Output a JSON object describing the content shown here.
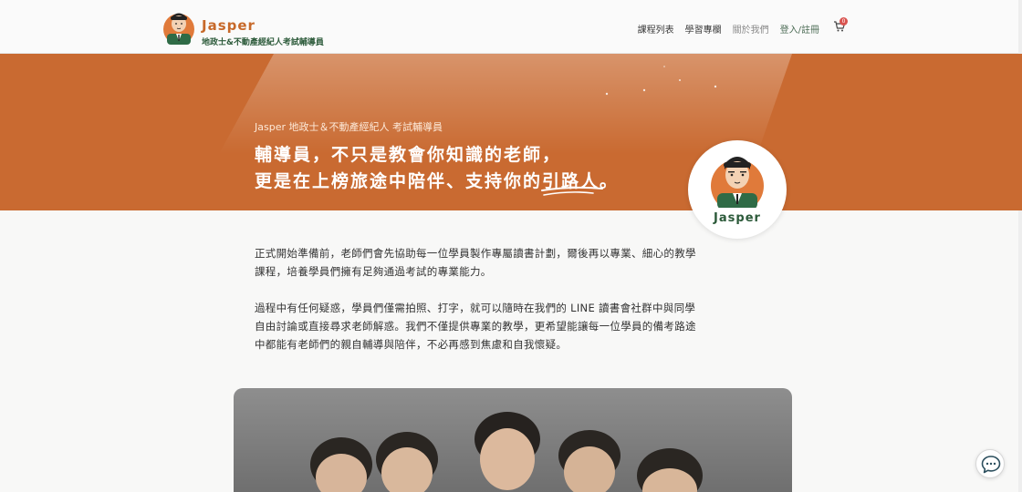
{
  "header": {
    "brand_name": "Jasper",
    "brand_tagline": "地政士&不動產經紀人考試輔導員",
    "nav": [
      {
        "label": "課程列表"
      },
      {
        "label": "學習專欄"
      },
      {
        "label": "關於我們"
      },
      {
        "label": "登入/註冊"
      }
    ],
    "cart_count": "0"
  },
  "hero": {
    "subtitle": "Jasper 地政士＆不動產經紀人 考試輔導員",
    "line1": "輔導員，不只是教會你知識的老師，",
    "line2": "更是在上榜旅途中陪伴、支持你的引路人。",
    "avatar_name": "Jasper"
  },
  "body": {
    "paragraph1": "正式開始準備前，老師們會先協助每一位學員製作專屬讀書計劃，爾後再以專業、細心的教學課程，培養學員們擁有足夠通過考試的專業能力。",
    "paragraph2": "過程中有任何疑惑，學員們僅需拍照、打字，就可以隨時在我們的 LINE 讀書會社群中與同學自由討論或直接尋求老師解惑。我們不僅提供專業的教學，更希望能讓每一位學員的備考路途中都能有老師們的親自輔導與陪伴，不必再感到焦慮和自我懷疑。"
  },
  "colors": {
    "hero_bg": "#c96a31",
    "brand_orange": "#c7692a",
    "brand_green": "#2c5a3a"
  },
  "icons": {
    "cart": "shopping-cart-icon",
    "chat": "chat-bubble-icon"
  }
}
